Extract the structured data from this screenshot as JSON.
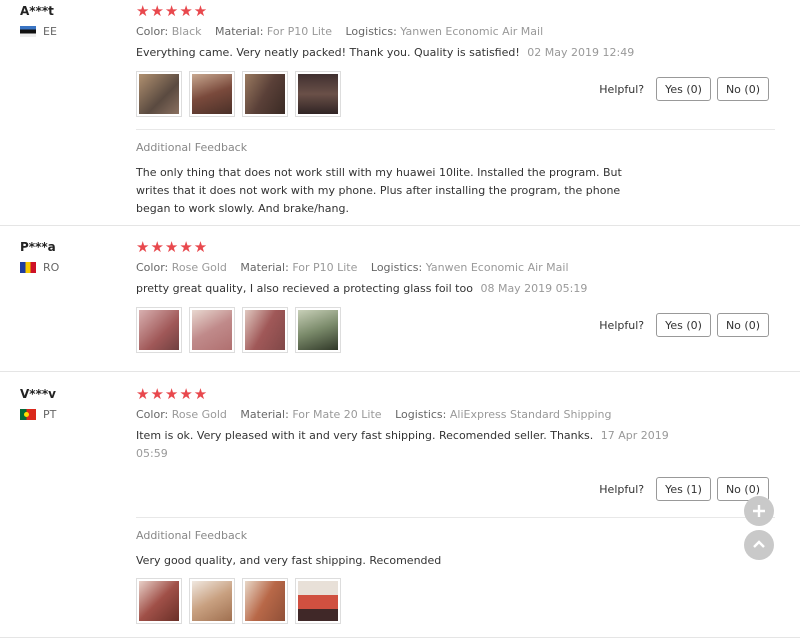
{
  "labels": {
    "color": "Color:",
    "material": "Material:",
    "logistics": "Logistics:",
    "helpful": "Helpful?",
    "additional_feedback": "Additional Feedback"
  },
  "stars": "★★★★★",
  "reviews": [
    {
      "user": "A***t",
      "country": "EE",
      "color": "Black",
      "material": "For P10 Lite",
      "logistics": "Yanwen Economic Air Mail",
      "text": "Everything came. Very neatly packed! Thank you. Quality is satisfied!",
      "date": "02 May 2019 12:49",
      "yes": "Yes (0)",
      "no": "No (0)",
      "additional_text": "The only thing that does not work still with my huawei 10lite. Installed the program. But writes that it does not work with my phone. Plus after installing the program, the phone began to work slowly. And brake/hang."
    },
    {
      "user": "P***a",
      "country": "RO",
      "color": "Rose Gold",
      "material": "For P10 Lite",
      "logistics": "Yanwen Economic Air Mail",
      "text": "pretty great quality, I also recieved a protecting glass foil too",
      "date": "08 May 2019 05:19",
      "yes": "Yes (0)",
      "no": "No (0)"
    },
    {
      "user": "V***v",
      "country": "PT",
      "color": "Rose Gold",
      "material": "For Mate 20 Lite",
      "logistics": "AliExpress Standard Shipping",
      "text": "Item is ok. Very pleased with it and very fast shipping. Recomended seller. Thanks.",
      "date": "17 Apr 2019 05:59",
      "yes": "Yes (1)",
      "no": "No (0)",
      "additional_text": "Very good quality, and very fast shipping. Recomended"
    }
  ],
  "photo_colors": {
    "r1": [
      "#8a7060",
      "#7a4a3c",
      "#5a4038",
      "#3a3030"
    ],
    "r2": [
      "#b06a6a",
      "#c08a8a",
      "#a05858",
      "#7a8a6a"
    ],
    "r3": [
      "#a05048",
      "#c8a080",
      "#b86848",
      "#d05040"
    ]
  },
  "fab_icons": [
    "plus-icon",
    "chevron-up-icon"
  ]
}
